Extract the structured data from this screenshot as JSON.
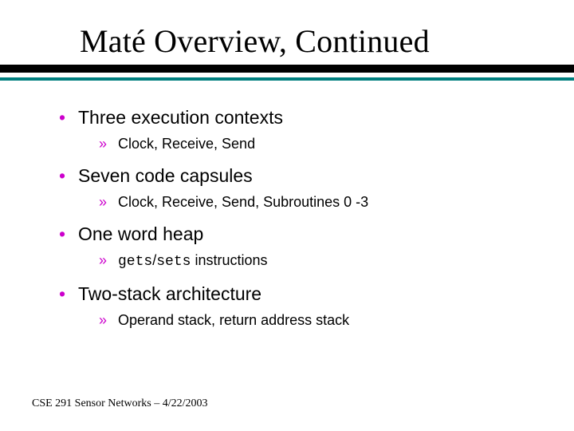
{
  "title": "Maté Overview, Continued",
  "bullets": [
    {
      "text": "Three execution contexts",
      "sub": [
        {
          "text": "Clock, Receive, Send"
        }
      ]
    },
    {
      "text": "Seven code capsules",
      "sub": [
        {
          "text": "Clock, Receive, Send, Subroutines 0 -3"
        }
      ]
    },
    {
      "text": "One word heap",
      "sub": [
        {
          "code1": "gets",
          "slash": "/",
          "code2": "sets",
          "rest": " instructions"
        }
      ]
    },
    {
      "text": "Two-stack architecture",
      "sub": [
        {
          "text": "Operand stack, return address stack"
        }
      ]
    }
  ],
  "footer": "CSE 291 Sensor Networks – 4/22/2003"
}
